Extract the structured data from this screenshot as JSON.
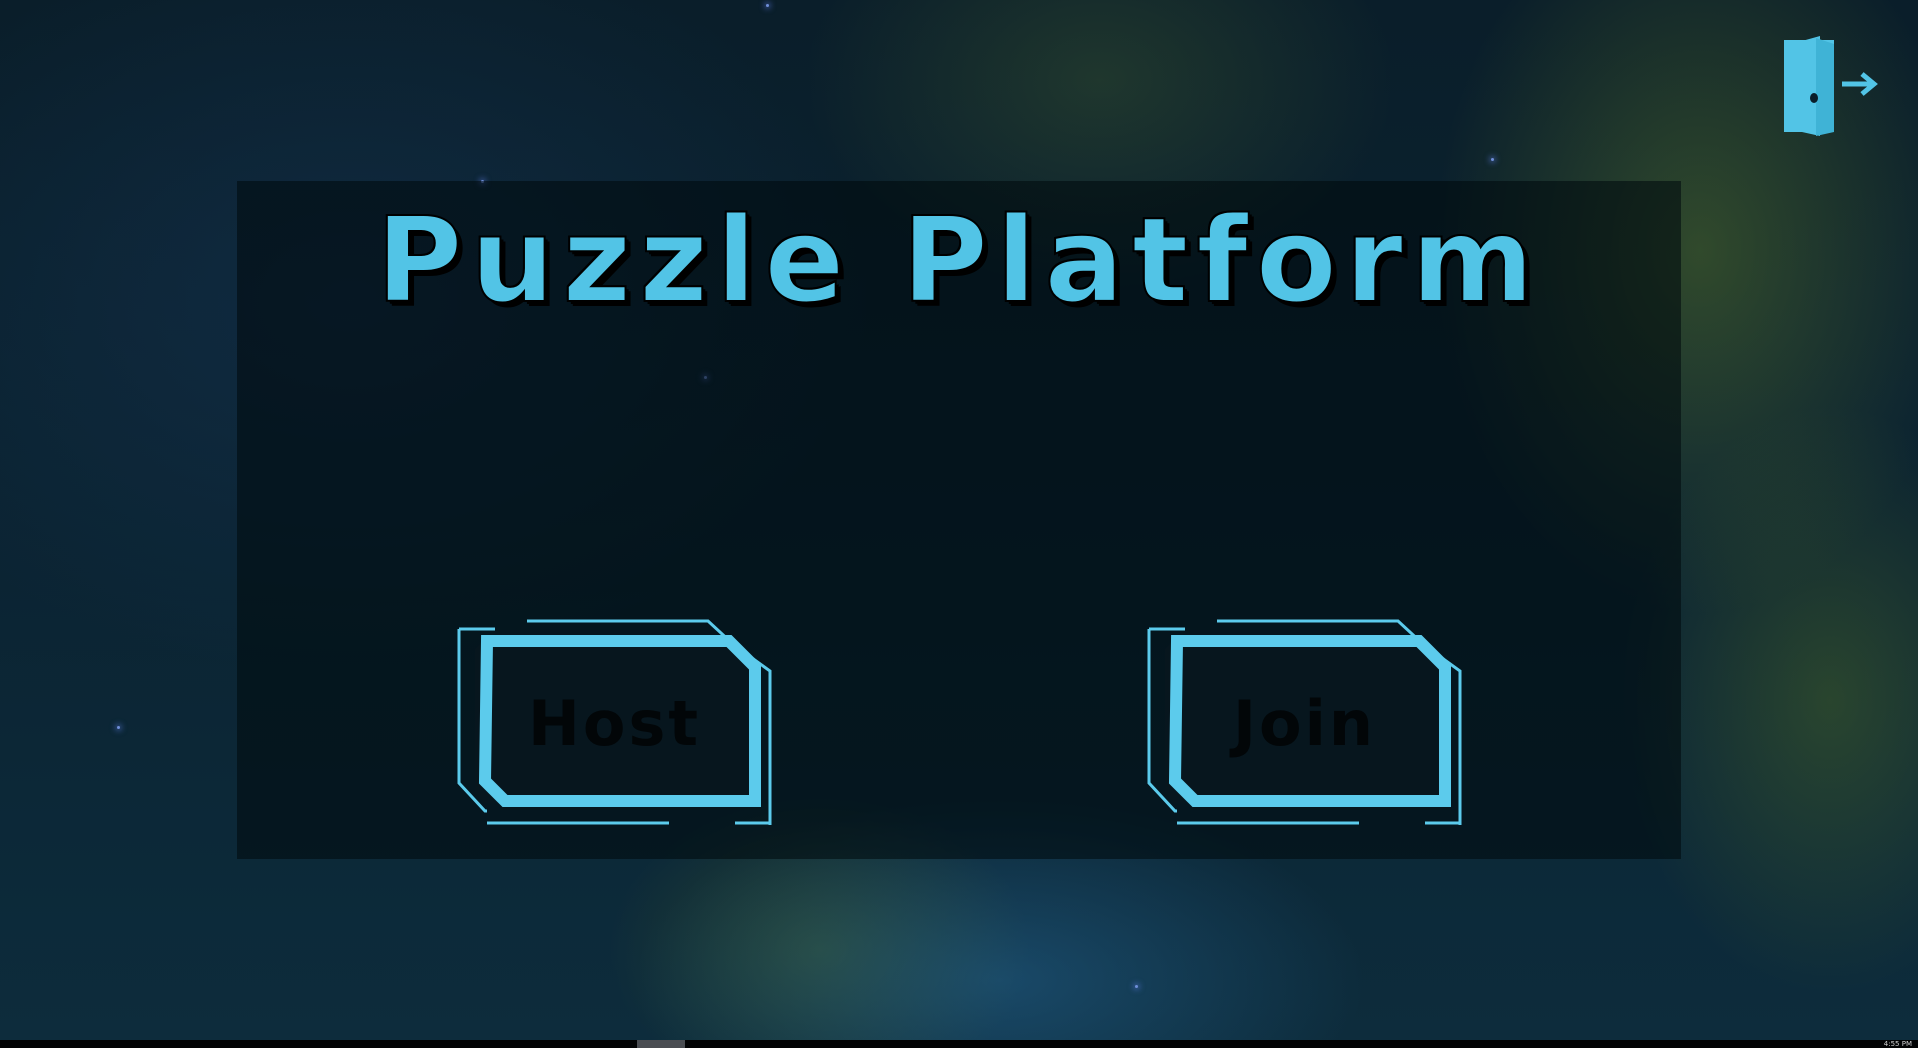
{
  "title": "Puzzle Platform",
  "buttons": {
    "host_label": "Host",
    "join_label": "Join"
  },
  "icons": {
    "exit": "exit-door-icon"
  },
  "taskbar": {
    "clock": "4:55 PM"
  },
  "colors": {
    "accent": "#52c4e6",
    "panel": "#000a0e",
    "label_text": "#020608"
  }
}
